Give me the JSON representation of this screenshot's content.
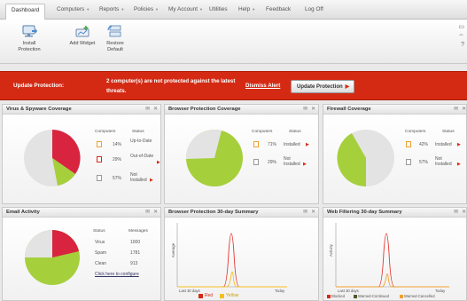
{
  "nav": {
    "items": [
      {
        "label": "Dashboard",
        "dropdown": false,
        "active": true
      },
      {
        "label": "Computers",
        "dropdown": true
      },
      {
        "label": "Reports",
        "dropdown": true
      },
      {
        "label": "Policies",
        "dropdown": true
      },
      {
        "label": "My Account",
        "dropdown": true
      },
      {
        "label": "Utilities",
        "dropdown": false
      },
      {
        "label": "Help",
        "dropdown": true
      },
      {
        "label": "Feedback",
        "dropdown": false
      },
      {
        "label": "Log Off",
        "dropdown": false
      }
    ]
  },
  "toolbar": {
    "install": [
      "Install",
      "Protection"
    ],
    "add_widget": "Add Widget",
    "restore": [
      "Restore",
      "Default"
    ]
  },
  "alert": {
    "label": "Update Protection:",
    "message": "2 computer(s) are not protected against the latest threats.",
    "dismiss": "Dismiss Alert",
    "button": "Update Protection",
    "color": "#d42a14"
  },
  "panels": {
    "virus": {
      "title": "Virus & Spyware Coverage",
      "col_headers": [
        "Computers",
        "Status"
      ],
      "rows": [
        {
          "value": "14%",
          "status": "Up-to-Date",
          "flag": false
        },
        {
          "value": "29%",
          "status": "Out-of-Date",
          "flag": true
        },
        {
          "value": "57%",
          "status": "Not Installed",
          "flag": true
        }
      ]
    },
    "browser": {
      "title": "Browser Protection Coverage",
      "col_headers": [
        "Computers",
        "Status"
      ],
      "rows": [
        {
          "value": "71%",
          "status": "Installed",
          "flag": true
        },
        {
          "value": "29%",
          "status": "Not Installed",
          "flag": true
        }
      ]
    },
    "firewall": {
      "title": "Firewall Coverage",
      "col_headers": [
        "Computers",
        "Status"
      ],
      "rows": [
        {
          "value": "42%",
          "status": "Installed",
          "flag": true
        },
        {
          "value": "57%",
          "status": "Not Installed",
          "flag": true
        }
      ]
    },
    "email": {
      "title": "Email Activity",
      "col_headers": [
        "Status",
        "Messages"
      ],
      "rows": [
        {
          "status": "Virus",
          "value": "1000"
        },
        {
          "status": "Spam",
          "value": "1781"
        },
        {
          "status": "Clean",
          "value": "913"
        }
      ],
      "link": "Click here to configure"
    },
    "bp30": {
      "title": "Browser Protection 30-day Summary",
      "ylabel": "Average",
      "xstart": "Last 30 days",
      "xend": "Today",
      "legend": [
        "Red",
        "Yellow"
      ]
    },
    "wf30": {
      "title": "Web Filtering 30-day Summary",
      "ylabel": "Activity",
      "xstart": "Last 30 days",
      "xend": "Today",
      "legend": [
        "Blocked",
        "Warned-Continued",
        "Warned-Cancelled"
      ]
    }
  },
  "colors": {
    "red": "#d42a14",
    "pie_red": "#d8243f",
    "pie_green": "#a6cf3c",
    "pie_grey": "#e3e3e3",
    "line_red": "#e3342f",
    "line_yellow": "#f4c020",
    "legend_orange": "#f0a030",
    "legend_dark": "#4f5a28"
  }
}
